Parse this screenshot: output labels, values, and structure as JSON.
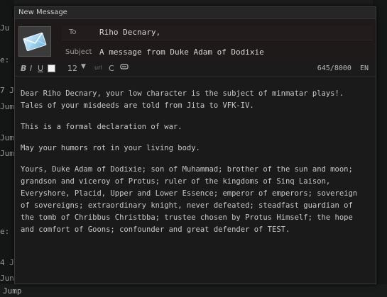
{
  "background": {
    "left_fragments": [
      "Ju",
      "e: 9",
      "7 Ju",
      "Jump",
      "Jump-",
      "Jump",
      "e: 2",
      "4 J",
      "Jun"
    ],
    "bottom_jump": "Jump"
  },
  "window": {
    "title": "New Message"
  },
  "header": {
    "icon": "envelope-icon",
    "to_label": "To",
    "to_value": "Riho Decnary,",
    "subject_label": "Subject",
    "subject_value": "A message from Duke Adam of Dodixie"
  },
  "toolbar": {
    "bold": "B",
    "italic": "I",
    "underline": "U",
    "font_size": "12",
    "url": "url",
    "color_c": "C",
    "counter": "645/8000",
    "language": "EN"
  },
  "message": {
    "paragraphs": [
      "Dear Riho Decnary, your low character is the subject of minmatar plays!. Tales of your misdeeds are told from Jita to VFK-IV.",
      "This is a formal declaration of war.",
      "May your humors rot in your living body.",
      "Yours, Duke Adam of Dodixie; son of Muhammad; brother of the sun and moon; grandson and viceroy of Protus; ruler of the kingdoms of Sinq Laison, Everyshore, Placid, Upper and Lower Essence; emperor of emperors; sovereign of sovereigns; extraordinary knight, never defeated; steadfast guardian of the tomb of Chribbus Christbba; trustee chosen by Protus Himself; the hope and comfort of Goons; confounder and great defender of TEST."
    ]
  },
  "colors": {
    "window_bg": "#1c1c1c",
    "header_bg": "#1f1a1a",
    "text": "#c9c9c9"
  }
}
